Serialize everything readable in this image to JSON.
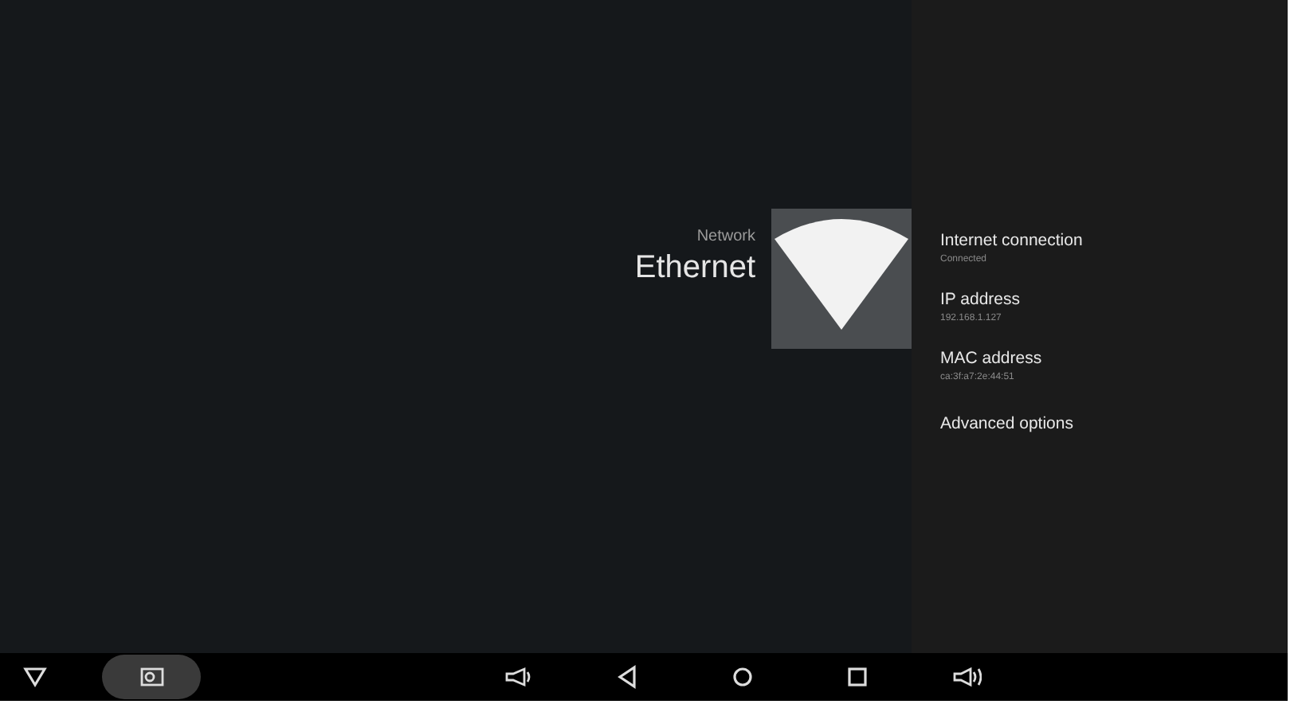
{
  "header": {
    "category": "Network",
    "title": "Ethernet"
  },
  "items": [
    {
      "title": "Internet connection",
      "summary": "Connected"
    },
    {
      "title": "IP address",
      "summary": "192.168.1.127"
    },
    {
      "title": "MAC address",
      "summary": "ca:3f:a7:2e:44:51"
    },
    {
      "title": "Advanced options"
    }
  ],
  "nav_bar": [
    {
      "kind": "hide",
      "highlighted": false
    },
    {
      "kind": "screenshot",
      "highlighted": true
    },
    {
      "kind": "volume-down",
      "highlighted": false
    },
    {
      "kind": "back",
      "highlighted": false
    },
    {
      "kind": "home",
      "highlighted": false
    },
    {
      "kind": "recents",
      "highlighted": false
    },
    {
      "kind": "volume-up",
      "highlighted": false
    }
  ]
}
